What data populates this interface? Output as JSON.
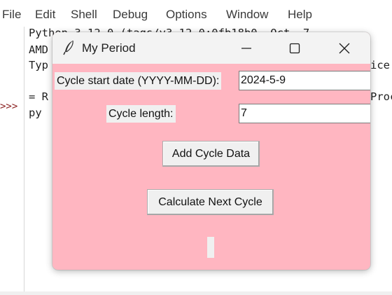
{
  "shell": {
    "menu": [
      "File",
      "Edit",
      "Shell",
      "Debug",
      "Options",
      "Window",
      "Help"
    ],
    "prompt": ">>>",
    "lines": [
      "Python 3.12.0 (tags/v3.12.0:0fb18b0, Oct  7",
      "AMD",
      "Typ",
      "",
      "= R",
      "py"
    ],
    "right_fragments": [
      "ice",
      "Proc"
    ]
  },
  "window": {
    "title": "My Period",
    "icon": "feather-icon",
    "background": "#ffb6c1",
    "controls": [
      "minimize-icon",
      "maximize-icon",
      "close-icon"
    ]
  },
  "form": {
    "start_date_label": "Cycle start date (YYYY-MM-DD):",
    "start_date_value": "2024-5-9",
    "cycle_length_label": "Cycle length:",
    "cycle_length_value": "7",
    "add_button": "Add Cycle Data",
    "calculate_button": "Calculate Next Cycle",
    "result_text": ""
  }
}
